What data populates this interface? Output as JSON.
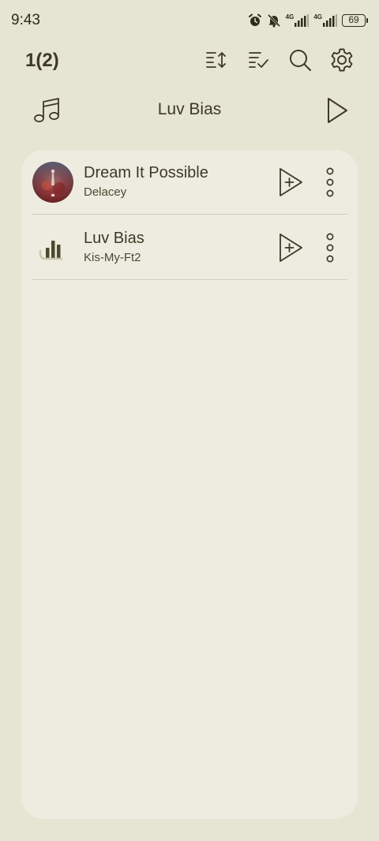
{
  "status_bar": {
    "time": "9:43",
    "battery": "69",
    "network_1": "4G",
    "network_2": "4G",
    "icons": [
      "alarm-icon",
      "bell-off-icon",
      "signal-icon",
      "signal-icon",
      "battery-icon"
    ]
  },
  "toolbar": {
    "title": "1(2)",
    "icons": [
      "sort-icon",
      "multi-select-icon",
      "search-icon",
      "settings-icon"
    ]
  },
  "now_playing": {
    "icon": "music-note-icon",
    "title": "Luv Bias",
    "play_icon": "play-icon"
  },
  "songs": [
    {
      "title": "Dream It Possible",
      "artist": "Delacey",
      "art": "album-art",
      "add_icon": "play-next-icon",
      "more_icon": "more-vertical-icon"
    },
    {
      "title": "Luv Bias",
      "artist": "Kis-My-Ft2",
      "art": "equalizer-icon",
      "add_icon": "play-next-icon",
      "more_icon": "more-vertical-icon"
    }
  ],
  "colors": {
    "background": "#e6e4d2",
    "card": "#eeece0",
    "text": "#3c3a26",
    "divider": "#cfcdbd"
  }
}
